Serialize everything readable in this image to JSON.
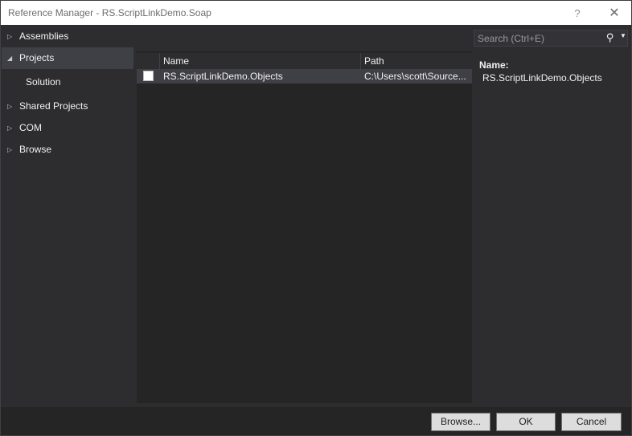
{
  "window": {
    "title": "Reference Manager - RS.ScriptLinkDemo.Soap",
    "help_glyph": "?",
    "close_glyph": "✕"
  },
  "nav": {
    "items": [
      {
        "label": "Assemblies",
        "arrow": "▷",
        "expanded": false
      },
      {
        "label": "Projects",
        "arrow": "◢",
        "expanded": true,
        "selected": true
      },
      {
        "label": "Solution",
        "child": true
      },
      {
        "label": "Shared Projects",
        "arrow": "▷",
        "expanded": false
      },
      {
        "label": "COM",
        "arrow": "▷",
        "expanded": false
      },
      {
        "label": "Browse",
        "arrow": "▷",
        "expanded": false
      }
    ]
  },
  "list": {
    "columns": [
      "Name",
      "Path"
    ],
    "rows": [
      {
        "checked": false,
        "name": "RS.ScriptLinkDemo.Objects",
        "path": "C:\\Users\\scott\\Source..."
      }
    ]
  },
  "search": {
    "placeholder": "Search (Ctrl+E)",
    "icon": "⚲",
    "dropdown": "▼"
  },
  "details": {
    "name_label": "Name:",
    "name_value": "RS.ScriptLinkDemo.Objects"
  },
  "buttons": {
    "browse": "Browse...",
    "ok": "OK",
    "cancel": "Cancel"
  }
}
